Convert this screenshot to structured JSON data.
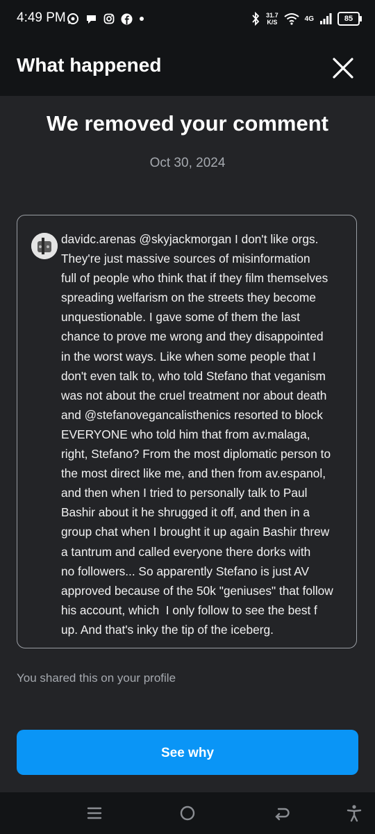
{
  "status_bar": {
    "time": "4:49 PM",
    "left_icons": [
      "whatsapp-icon",
      "chat-icon",
      "instagram-icon",
      "facebook-icon",
      "dot-icon"
    ],
    "net_speed_value": "31.7",
    "net_speed_unit": "K/S",
    "network_type": "4G",
    "battery": "85"
  },
  "header": {
    "title": "What happened",
    "close_icon": "close-icon"
  },
  "main": {
    "title": "We removed your comment",
    "date": "Oct 30, 2024"
  },
  "comment": {
    "text": "davidc.arenas @skyjackmorgan I don't like orgs.\nThey're just massive sources of misinformation\nfull of people who think that if they film themselves\nspreading welfarism on the streets they become\nunquestionable. I gave some of them the last\nchance to prove me wrong and they disappointed\nin the worst ways. Like when some people that I\ndon't even talk to, who told Stefano that veganism\nwas not about the cruel treatment nor about death\nand @stefanovegancalisthenics resorted to block\nEVERYONE who told him that from av.malaga,\nright, Stefano? From the most diplomatic person to\nthe most direct like me, and then from av.espanol,\nand then when I tried to personally talk to Paul\nBashir about it he shrugged it off, and then in a\ngroup chat when I brought it up again Bashir threw\na tantrum and called everyone there dorks with\nno followers... So apparently Stefano is just AV\napproved because of the 50k \"geniuses\" that follow\nhis account, which  I only follow to see the best f\nup. And that's inky the tip of the iceberg."
  },
  "shared_note": "You shared this on your profile",
  "button": {
    "label": "See why"
  },
  "nav_bar": {
    "items": [
      "menu-icon",
      "home-icon",
      "back-icon",
      "accessibility-icon"
    ]
  },
  "colors": {
    "background": "#232427",
    "header_bg": "#121416",
    "accent": "#0a95f6",
    "muted_text": "#a5a9af"
  }
}
